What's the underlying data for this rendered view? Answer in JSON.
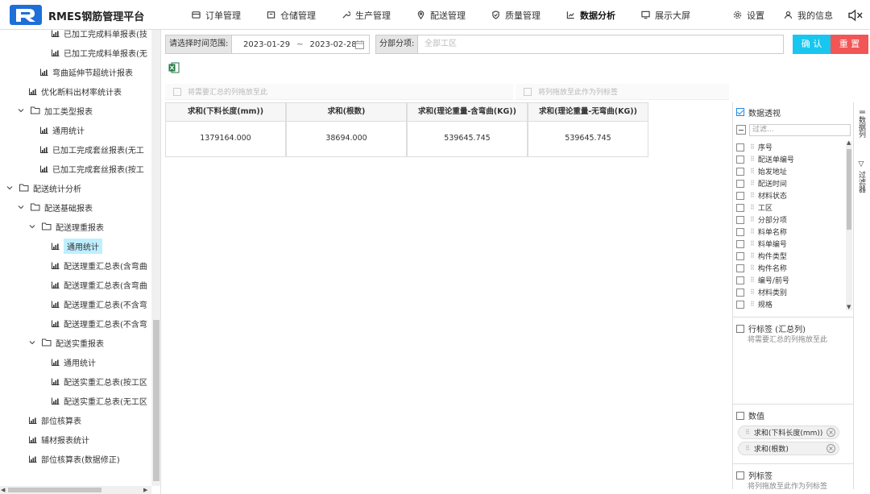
{
  "app": {
    "title": "RMES钢筋管理平台",
    "brand_color": "#1e6fd8"
  },
  "nav": {
    "items": [
      {
        "label": "订单管理",
        "icon": "cart-icon"
      },
      {
        "label": "仓储管理",
        "icon": "warehouse-icon"
      },
      {
        "label": "生产管理",
        "icon": "wrench-icon"
      },
      {
        "label": "配送管理",
        "icon": "location-icon"
      },
      {
        "label": "质量管理",
        "icon": "shield-icon"
      },
      {
        "label": "数据分析",
        "icon": "chart-icon",
        "active": true
      },
      {
        "label": "展示大屏",
        "icon": "monitor-icon"
      }
    ],
    "settings_label": "设置",
    "profile_label": "我的信息"
  },
  "sidebar": {
    "items": [
      {
        "label": "已加工完成料单报表(技",
        "level": 4,
        "icon": "report-icon"
      },
      {
        "label": "已加工完成料单报表(无",
        "level": 4,
        "icon": "report-icon"
      },
      {
        "label": "弯曲延伸节超统计报表",
        "level": 3,
        "icon": "report-icon"
      },
      {
        "label": "优化断料出材率统计表",
        "level": 2,
        "icon": "report-icon"
      },
      {
        "label": "加工类型报表",
        "level": 1,
        "icon": "folder-icon",
        "expanded": true
      },
      {
        "label": "通用统计",
        "level": 3,
        "icon": "report-icon"
      },
      {
        "label": "已加工完成套丝报表(无工",
        "level": 3,
        "icon": "report-icon"
      },
      {
        "label": "已加工完成套丝报表(按工",
        "level": 3,
        "icon": "report-icon"
      },
      {
        "label": "配送统计分析",
        "level": 0,
        "icon": "folder-icon",
        "expanded": true
      },
      {
        "label": "配送基础报表",
        "level": 1,
        "icon": "folder-icon",
        "expanded": true
      },
      {
        "label": "配送理重报表",
        "level": 2,
        "icon": "folder-icon",
        "expanded": true
      },
      {
        "label": "通用统计",
        "level": 4,
        "icon": "report-icon",
        "selected": true
      },
      {
        "label": "配送理重汇总表(含弯曲",
        "level": 4,
        "icon": "report-icon"
      },
      {
        "label": "配送理重汇总表(含弯曲",
        "level": 4,
        "icon": "report-icon"
      },
      {
        "label": "配送理重汇总表(不含弯",
        "level": 4,
        "icon": "report-icon"
      },
      {
        "label": "配送理重汇总表(不含弯",
        "level": 4,
        "icon": "report-icon"
      },
      {
        "label": "配送实重报表",
        "level": 2,
        "icon": "folder-icon",
        "expanded": true
      },
      {
        "label": "通用统计",
        "level": 4,
        "icon": "report-icon"
      },
      {
        "label": "配送实重汇总表(按工区",
        "level": 4,
        "icon": "report-icon"
      },
      {
        "label": "配送实重汇总表(无工区",
        "level": 4,
        "icon": "report-icon"
      },
      {
        "label": "部位核算表",
        "level": 2,
        "icon": "report-icon"
      },
      {
        "label": "辅材报表统计",
        "level": 2,
        "icon": "report-icon"
      },
      {
        "label": "部位核算表(数据修正)",
        "level": 2,
        "icon": "report-icon"
      }
    ]
  },
  "filter": {
    "date_label": "请选择时间范围:",
    "date_start": "2023-01-29",
    "date_sep": "~",
    "date_end": "2023-02-28",
    "area_label": "分部分项:",
    "area_placeholder": "全部工区",
    "confirm_label": "确 认",
    "reset_label": "重 置"
  },
  "pivot": {
    "row_drop_hint": "将需要汇总的列拖放至此",
    "col_drop_hint": "将列拖放至此作为列标签",
    "headers": [
      "求和(下料长度(mm))",
      "求和(根数)",
      "求和(理论重量-含弯曲(KG))",
      "求和(理论重量-无弯曲(KG))"
    ],
    "values": [
      "1379164.000",
      "38694.000",
      "539645.745",
      "539645.745"
    ]
  },
  "field_panel": {
    "title": "数据透视",
    "filter_placeholder": "过滤...",
    "fields": [
      "序号",
      "配送单编号",
      "始发地址",
      "配送时间",
      "材料状态",
      "工区",
      "分部分项",
      "料单名称",
      "料单编号",
      "构件类型",
      "构件名称",
      "编号/前号",
      "材料类别",
      "规格"
    ],
    "row_section_title": "行标签 (汇总列)",
    "row_section_hint": "将需要汇总的列拖放至此",
    "values_section_title": "数值",
    "value_chips": [
      "求和(下料长度(mm))",
      "求和(根数)"
    ],
    "col_section_title": "列标签",
    "col_section_hint": "将列拖放至此作为列标签",
    "tab_columns": "数据列",
    "tab_filter": "过滤器"
  }
}
